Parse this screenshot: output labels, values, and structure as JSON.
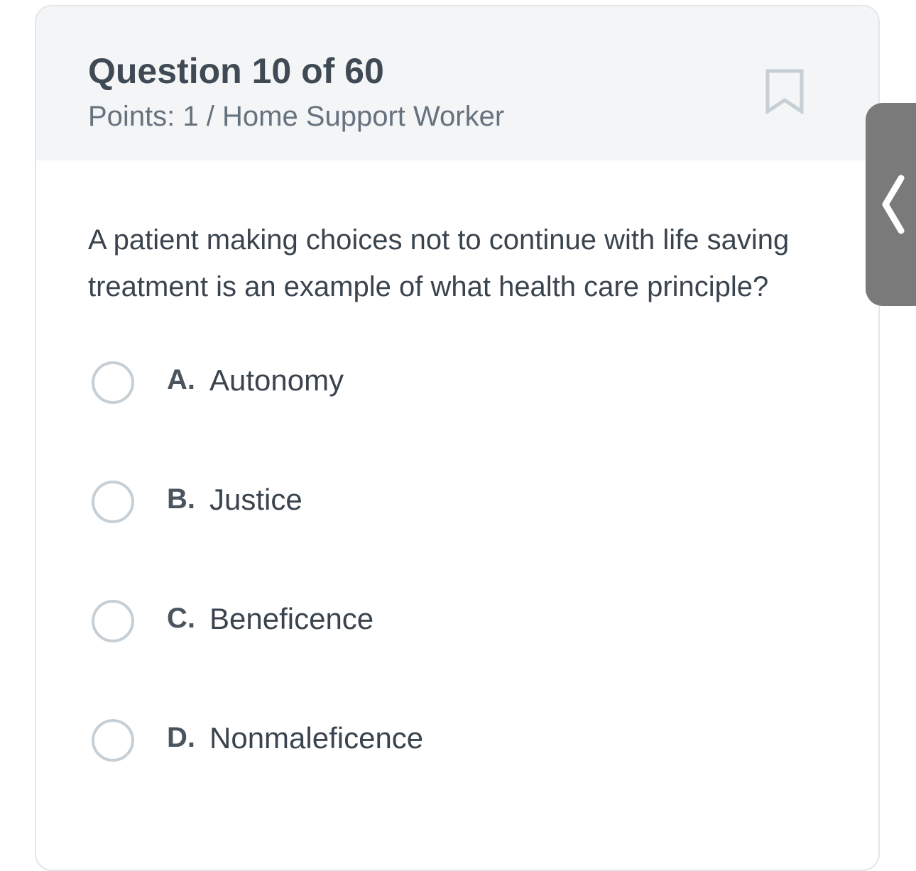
{
  "header": {
    "title": "Question 10 of 60",
    "points": "Points: 1 / Home Support Worker"
  },
  "question": {
    "text": "A patient making choices not to continue with life saving treatment is an example of what health care principle?"
  },
  "options": [
    {
      "letter": "A.",
      "text": "Autonomy"
    },
    {
      "letter": "B.",
      "text": "Justice"
    },
    {
      "letter": "C.",
      "text": "Beneficence"
    },
    {
      "letter": "D.",
      "text": "Nonmaleficence"
    }
  ],
  "icons": {
    "bookmark": "bookmark-icon",
    "side_tab": "chevron-left-icon"
  },
  "colors": {
    "header_bg": "#f3f5f6",
    "title": "#3f4a55",
    "radio_border": "#c6cfd6",
    "side_tab": "#7a7a7a"
  }
}
